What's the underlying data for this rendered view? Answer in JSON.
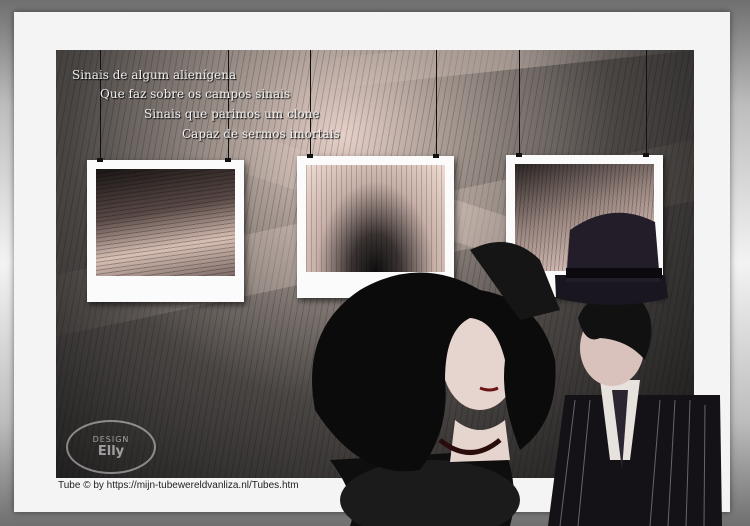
{
  "poem": {
    "line1": "Sinais de algum alienígena",
    "line2": "Que faz sobre os campos sinais",
    "line3": "Sinais que parimos um clone",
    "line4": "Capaz de sermos imortais"
  },
  "credit": "Tube © by https://mijn-tubewereldvanliza.nl/Tubes.htm",
  "watermark": {
    "line1": "DESIGN",
    "line2": "Elly"
  }
}
